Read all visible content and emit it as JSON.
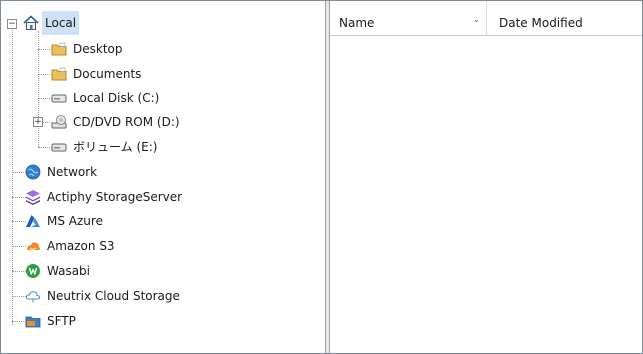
{
  "tree": {
    "items": [
      {
        "label": "Local",
        "icon": "home-icon",
        "selected": true
      },
      {
        "label": "Desktop",
        "icon": "folder-icon"
      },
      {
        "label": "Documents",
        "icon": "folder-icon"
      },
      {
        "label": "Local Disk (C:)",
        "icon": "drive-icon"
      },
      {
        "label": "CD/DVD ROM (D:)",
        "icon": "cd-drive-icon"
      },
      {
        "label": "ボリューム (E:)",
        "icon": "drive-icon"
      },
      {
        "label": "Network",
        "icon": "network-globe-icon"
      },
      {
        "label": "Actiphy StorageServer",
        "icon": "actiphy-storage-icon"
      },
      {
        "label": "MS Azure",
        "icon": "azure-icon"
      },
      {
        "label": "Amazon S3",
        "icon": "amazon-s3-icon"
      },
      {
        "label": "Wasabi",
        "icon": "wasabi-icon"
      },
      {
        "label": "Neutrix Cloud Storage",
        "icon": "cloud-icon"
      },
      {
        "label": "SFTP",
        "icon": "sftp-icon"
      }
    ],
    "expander_collapse": "−",
    "expander_expand": "+"
  },
  "list": {
    "columns": [
      {
        "label": "Name"
      },
      {
        "label": "Date Modified"
      }
    ],
    "sort_indicator": "⌄"
  },
  "colors": {
    "selection": "#cfe1f6",
    "folder": "#e8c15a",
    "azure": "#1a5fb4",
    "amazon": "#f08c2a",
    "wasabi": "#2ea043",
    "network": "#2f7fd0",
    "actiphy": "#7a4bc2"
  }
}
